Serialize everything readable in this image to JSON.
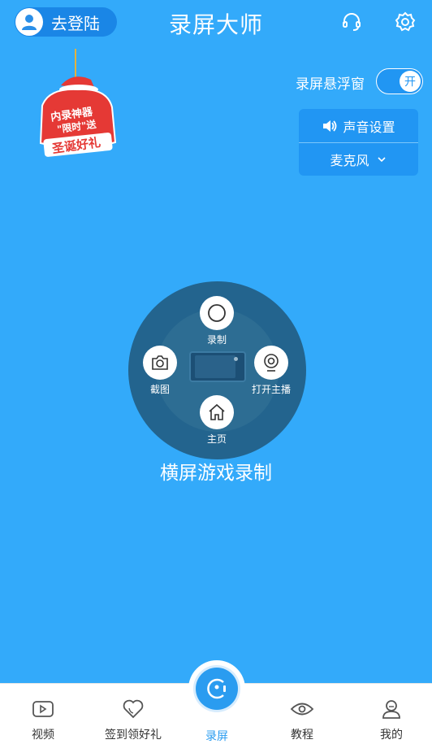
{
  "header": {
    "login_label": "去登陆",
    "title": "录屏大师",
    "icons": [
      "customer-service-icon",
      "gear-icon"
    ]
  },
  "promo": {
    "line1": "内录神器",
    "line2": "\"限时\"送",
    "line3": "圣诞好礼"
  },
  "float_window": {
    "label": "录屏悬浮窗",
    "toggle_text": "开",
    "enabled": true
  },
  "audio": {
    "settings_label": "声音设置",
    "source_label": "麦克风"
  },
  "radial_menu": {
    "record": "录制",
    "screenshot": "截图",
    "live": "打开主播",
    "home": "主页"
  },
  "mode_title": "横屏游戏录制",
  "colors": {
    "background": "#33aafa",
    "accent": "#2196f3",
    "radial": "#23648e"
  },
  "bottom_nav": {
    "items": [
      {
        "label": "视频",
        "icon": "video-icon"
      },
      {
        "label": "签到领好礼",
        "icon": "heart-icon"
      },
      {
        "label": "录屏",
        "icon": "record-icon",
        "active": true
      },
      {
        "label": "教程",
        "icon": "eye-icon"
      },
      {
        "label": "我的",
        "icon": "user-icon"
      }
    ]
  }
}
